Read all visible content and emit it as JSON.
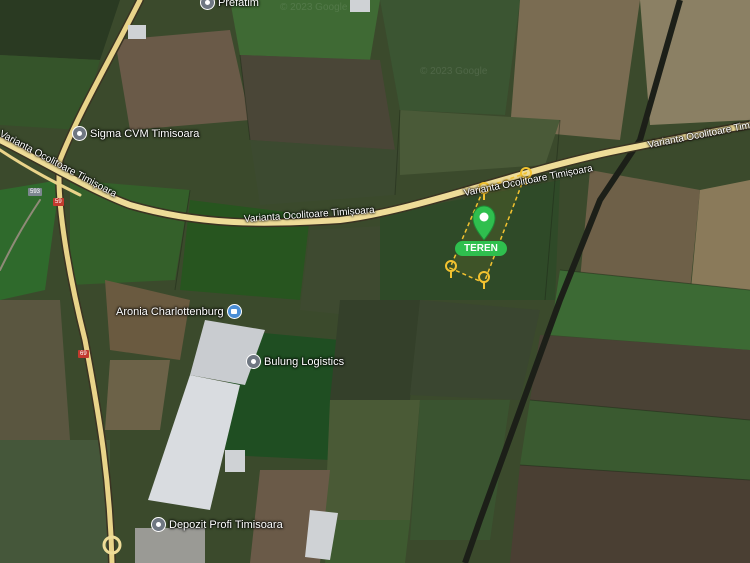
{
  "pois": {
    "prefatim": "Prefatim",
    "sigma": "Sigma CVM Timisoara",
    "aronia": "Aronia Charlottenburg",
    "bulung": "Bulung Logistics",
    "depozit": "Depozit Profi Timisoara"
  },
  "roads": {
    "varianta_main": "Varianta Ocolitoare Timișoara",
    "varianta_right": "Varianta Ocolitoare Timișoara",
    "varianta_far": "Varianta Ocolitoare Timișoara",
    "varianta_left": "Varianta Ocolitoare Timișoara",
    "shield_593": "593",
    "shield_69a": "59",
    "shield_69b": "69"
  },
  "marker": {
    "label": "TEREN",
    "color": "#2fbf4e",
    "outline_color": "#f2c230"
  },
  "watermarks": [
    "© 2023 Google",
    "© 2023 Google"
  ],
  "colors": {
    "road": "#e9d48a",
    "field_dark": "#2f3f22",
    "field_green": "#3f6a2c"
  }
}
